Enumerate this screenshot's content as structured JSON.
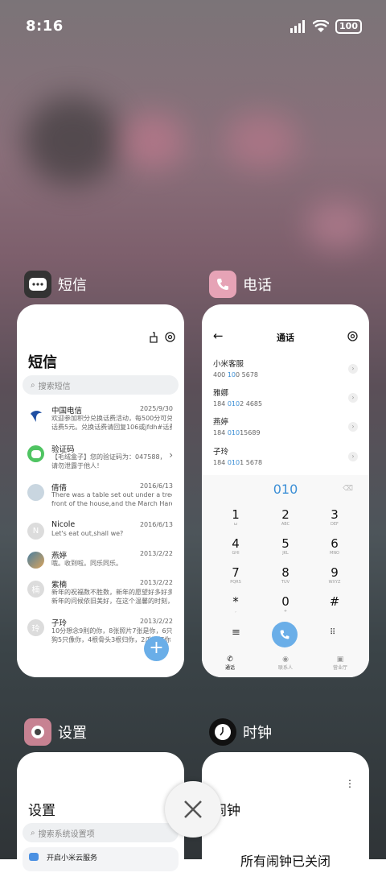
{
  "status": {
    "time": "8:16",
    "battery": "100"
  },
  "apps": {
    "sms": {
      "header": "短信",
      "title": "短信",
      "search_placeholder": "搜索短信",
      "messages": [
        {
          "name": "中国电信",
          "date": "2025/9/30",
          "line1": "欢迎参加积分兑换话费活动，每500分可兑换",
          "line2": "话费5元。兑换话费请回复106或jfdh#话费..."
        },
        {
          "name": "验证码",
          "date": "",
          "line1": "【毛绒盒子】您的验证码为：047588，",
          "line2": "请勿泄露于他人！"
        },
        {
          "name": "倩倩",
          "date": "2016/6/13",
          "line1": "There was a table set out under a tree in",
          "line2": "front of the house,and the March Hare an..."
        },
        {
          "name": "Nicole",
          "date": "2016/6/13",
          "line1": "Let's eat out,shall we?",
          "line2": ""
        },
        {
          "name": "燕婷",
          "date": "2013/2/22",
          "line1": "哦。收到啦。同乐同乐。",
          "line2": ""
        },
        {
          "name": "紫楠",
          "date": "2013/2/22",
          "line1": "新年的祝福数不胜数，新年的愿望好多好多，",
          "line2": "新年的问候依旧美好，在这个温馨的时刻，..."
        },
        {
          "name": "子玲",
          "date": "2013/2/22",
          "line1": "10分想念9則的你，8张照片7张是你，6只小",
          "line2": "狗5只像你，4根骨头3根归你，2爪看好你"
        }
      ],
      "avatar_letters": [
        "",
        "",
        "",
        "N",
        "",
        "楠",
        "玲"
      ]
    },
    "phone": {
      "header": "电话",
      "title": "通话",
      "contacts": [
        {
          "name": "小米客服",
          "pre": "400 ",
          "hl": "10",
          "post": "0 5678"
        },
        {
          "name": "雅娜",
          "pre": "184 ",
          "hl": "010",
          "post": "2 4685"
        },
        {
          "name": "燕婷",
          "pre": "184 ",
          "hl": "010",
          "post": "15689"
        },
        {
          "name": "子玲",
          "pre": "184 ",
          "hl": "010",
          "post": "1 5678"
        }
      ],
      "dial_input": "010",
      "keys": [
        {
          "d": "1",
          "l": "ω"
        },
        {
          "d": "2",
          "l": "ABC"
        },
        {
          "d": "3",
          "l": "DEF"
        },
        {
          "d": "4",
          "l": "GHI"
        },
        {
          "d": "5",
          "l": "JKL"
        },
        {
          "d": "6",
          "l": "MNO"
        },
        {
          "d": "7",
          "l": "PQRS"
        },
        {
          "d": "8",
          "l": "TUV"
        },
        {
          "d": "9",
          "l": "WXYZ"
        },
        {
          "d": "*",
          "l": ","
        },
        {
          "d": "0",
          "l": "+"
        },
        {
          "d": "#",
          "l": ""
        }
      ],
      "tabs": [
        "通话",
        "联系人",
        "营业厅"
      ]
    },
    "settings": {
      "header": "设置",
      "title": "设置",
      "search_placeholder": "搜索系统设置项",
      "first_item": "开启小米云服务"
    },
    "clock": {
      "header": "时钟",
      "title": "闹钟",
      "empty_text": "所有闹钟已关闭"
    }
  },
  "colors": {
    "accent": "#6aaee8",
    "call": "#6aaee8",
    "highlight": "#3c8fd6"
  }
}
